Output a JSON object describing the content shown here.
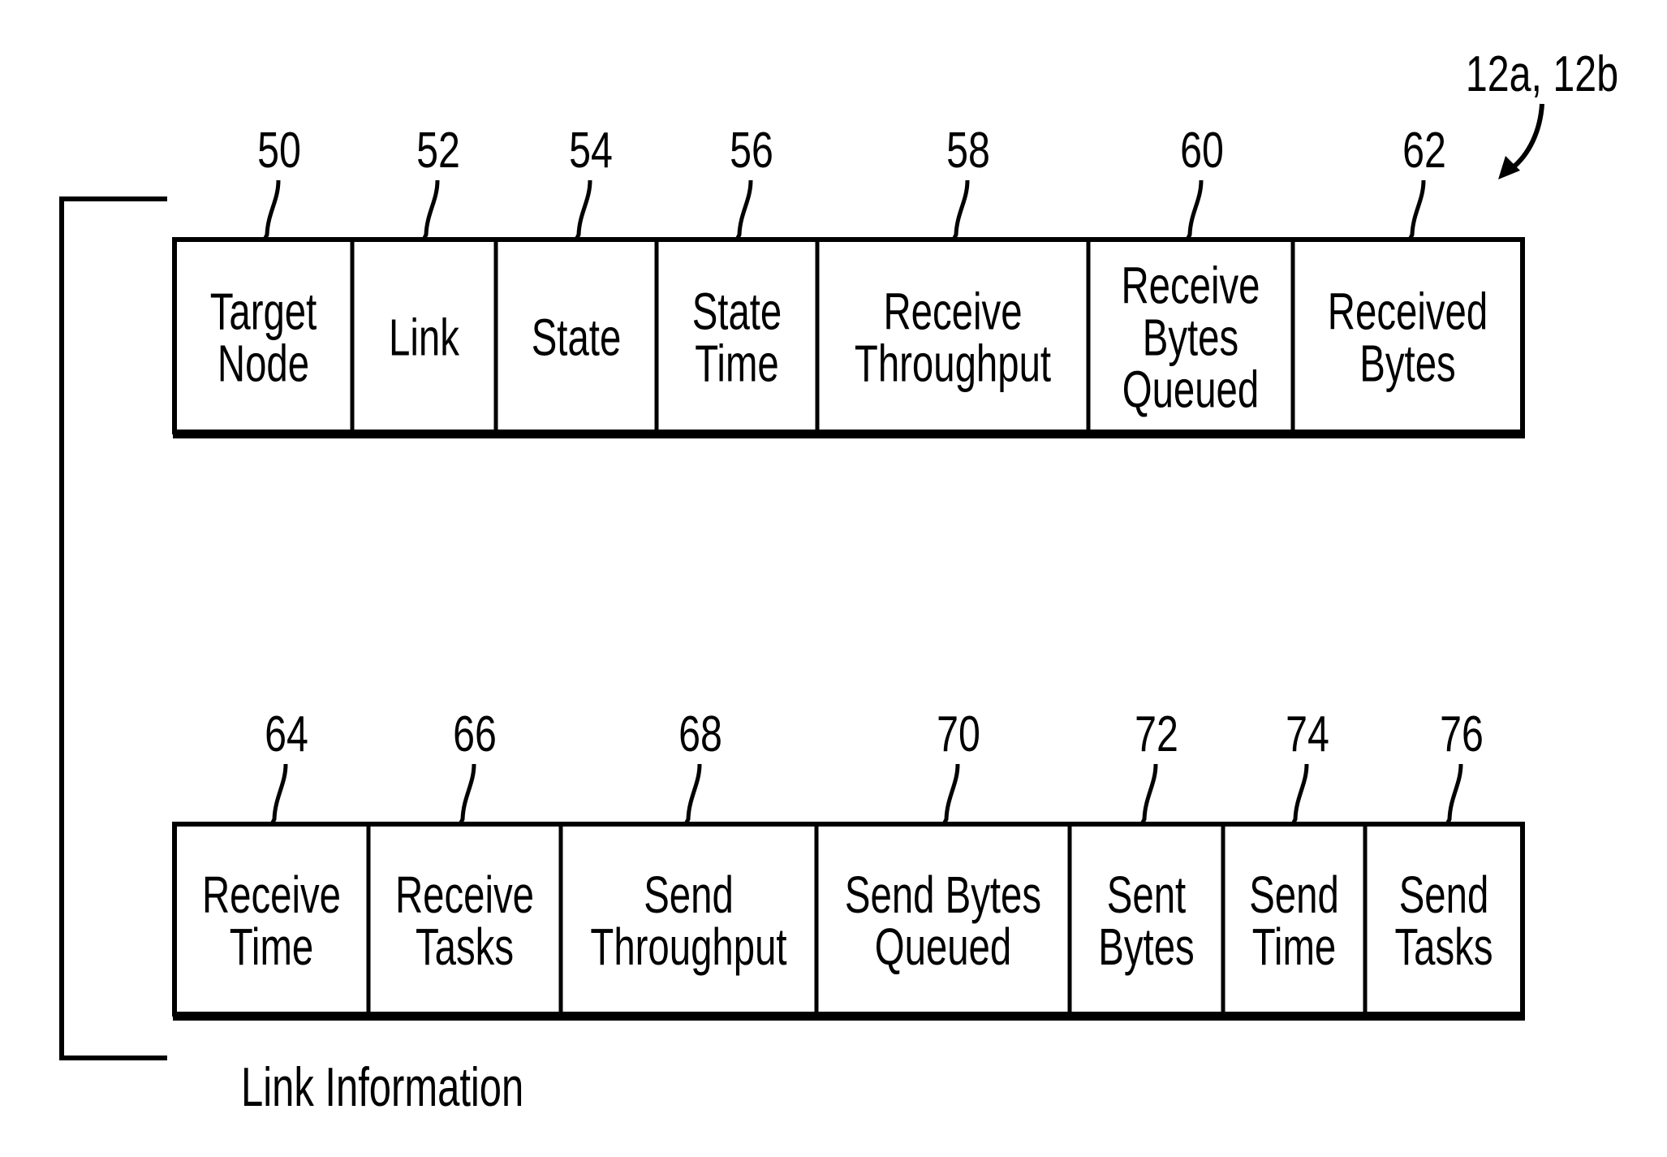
{
  "figure": {
    "group_label": "12a, 12b",
    "caption": "Link Information",
    "colors": {
      "ink": "#000000",
      "background": "#ffffff"
    }
  },
  "rows": [
    {
      "fields": [
        {
          "ref": "50",
          "lines": [
            "Target",
            "Node"
          ]
        },
        {
          "ref": "52",
          "lines": [
            "Link"
          ]
        },
        {
          "ref": "54",
          "lines": [
            "State"
          ]
        },
        {
          "ref": "56",
          "lines": [
            "State",
            "Time"
          ]
        },
        {
          "ref": "58",
          "lines": [
            "Receive",
            "Throughput"
          ]
        },
        {
          "ref": "60",
          "lines": [
            "Receive",
            "Bytes",
            "Queued"
          ]
        },
        {
          "ref": "62",
          "lines": [
            "Received",
            "Bytes"
          ]
        }
      ]
    },
    {
      "fields": [
        {
          "ref": "64",
          "lines": [
            "Receive",
            "Time"
          ]
        },
        {
          "ref": "66",
          "lines": [
            "Receive",
            "Tasks"
          ]
        },
        {
          "ref": "68",
          "lines": [
            "Send",
            "Throughput"
          ]
        },
        {
          "ref": "70",
          "lines": [
            "Send Bytes",
            "Queued"
          ]
        },
        {
          "ref": "72",
          "lines": [
            "Sent",
            "Bytes"
          ]
        },
        {
          "ref": "74",
          "lines": [
            "Send",
            "Time"
          ]
        },
        {
          "ref": "76",
          "lines": [
            "Send",
            "Tasks"
          ]
        }
      ]
    }
  ]
}
